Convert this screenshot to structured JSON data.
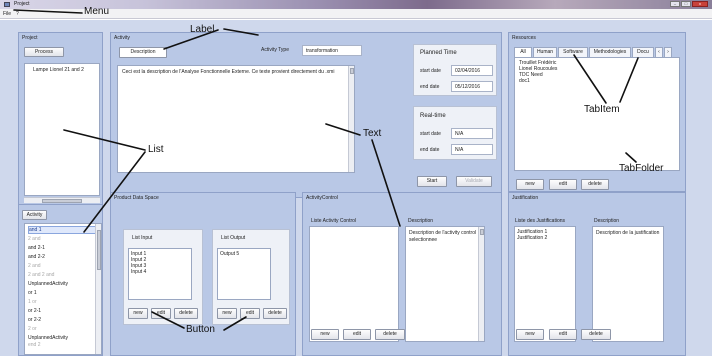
{
  "window": {
    "title": "Project"
  },
  "menu": {
    "file": "File",
    "help": "?"
  },
  "project_panel": {
    "title": "Project",
    "process_label": "Process",
    "items": [
      "Lampe Lionel 21 and 2"
    ],
    "activity_label": "Activity",
    "activities": [
      {
        "label": "and 1",
        "state": "selected"
      },
      {
        "label": "2 and",
        "state": "grey"
      },
      {
        "label": "and 2-1",
        "state": "normal"
      },
      {
        "label": "and 2-2",
        "state": "normal"
      },
      {
        "label": "2 and",
        "state": "grey"
      },
      {
        "label": "2 and 2 and",
        "state": "grey"
      },
      {
        "label": "UnplannedActivity",
        "state": "normal"
      },
      {
        "label": "or 1",
        "state": "normal"
      },
      {
        "label": "1 or",
        "state": "grey"
      },
      {
        "label": "or 2-1",
        "state": "normal"
      },
      {
        "label": "or 2-2",
        "state": "normal"
      },
      {
        "label": "2 or",
        "state": "grey"
      },
      {
        "label": "UnplannedActivity",
        "state": "normal"
      },
      {
        "label": "end 2",
        "state": "grey"
      }
    ]
  },
  "activity_panel": {
    "title": "Activity",
    "description_tab": "Description",
    "activity_type_label": "Activity Type",
    "activity_type_value": "transformation",
    "description_text": "Ceci est la description de l'Analyse Fonctionnelle Externe. Ce texte provient directement du .xmi",
    "planned_time": {
      "title": "Planned Time",
      "start_label": "start date",
      "start_value": "02/04/2016",
      "end_label": "end date",
      "end_value": "05/12/2016"
    },
    "real_time": {
      "title": "Real-time",
      "start_label": "start date",
      "start_value": "N/A",
      "end_label": "end date",
      "end_value": "N/A"
    },
    "start_button": "Start",
    "validate_button": "Validate"
  },
  "resources_panel": {
    "title": "Resources",
    "tabs": [
      "All",
      "Human",
      "Software",
      "Methodologies",
      "Docu"
    ],
    "items": [
      "Trouillet Frédéric",
      "Lionel Roucoules",
      "TDC Need",
      "doc1"
    ],
    "buttons": {
      "new": "new",
      "edit": "edit",
      "delete": "delete"
    }
  },
  "pds_panel": {
    "title": "Product Data Space",
    "list_input": {
      "title": "List Input",
      "items": [
        "Input 1",
        "Input 2",
        "Input 3",
        "Input 4"
      ]
    },
    "list_output": {
      "title": "List Output",
      "items": [
        "Output 5"
      ]
    },
    "buttons": {
      "new": "new",
      "edit": "edit",
      "delete": "delete"
    }
  },
  "activity_control_panel": {
    "title": "ActivityControl",
    "list_label": "Liste Activity Control",
    "description_label": "Description",
    "description_text": "Description de l'activity control selectionnee",
    "buttons": {
      "new": "new",
      "edit": "edit",
      "delete": "delete"
    }
  },
  "justification_panel": {
    "title": "Justification",
    "list_label": "Liste des Justifications",
    "items": [
      "Justification 1",
      "Justification 2"
    ],
    "description_label": "Description",
    "description_text": "Description de la justification",
    "buttons": {
      "new": "new",
      "edit": "edit",
      "delete": "delete"
    }
  },
  "annotations": {
    "menu": "Menu",
    "label": "Label",
    "list": "List",
    "text": "Text",
    "tabitem": "TabItem",
    "tabfolder": "TabFolder",
    "button": "Button"
  },
  "colors": {
    "panel": "#b9c8e6",
    "background": "#cfd8ec",
    "selection": "#dfe8fb"
  }
}
